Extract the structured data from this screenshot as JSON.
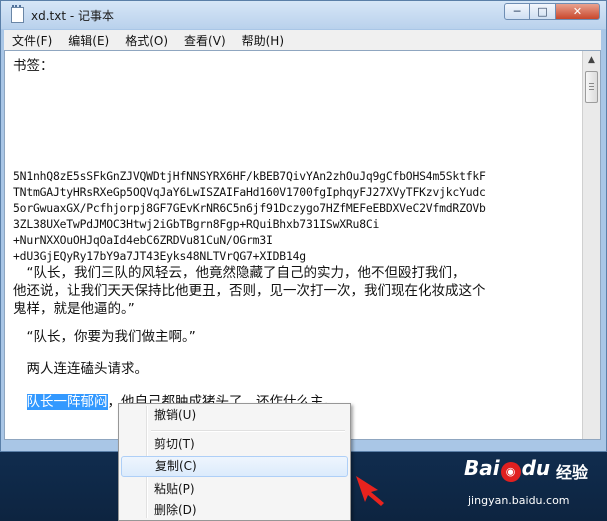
{
  "window": {
    "title": "xd.txt - 记事本",
    "controls": {
      "minimize": "─",
      "maximize": "□",
      "close": "✕"
    }
  },
  "menu": [
    "文件(F)",
    "编辑(E)",
    "格式(O)",
    "查看(V)",
    "帮助(H)"
  ],
  "editor": {
    "header": "书签：",
    "encoded_lines": [
      "5N1nhQ8zE5sSFkGnZJVQWDtjHfNNSYRX6HF/kBEB7QivYAn2zhOuJq9gCfbOHS4m5SktfkF",
      "TNtmGAJtyHRsRXeGp5OQVqJaY6LwISZAIFaHd160V1700fgIphqyFJ27XVyTFKzvjkcYudc",
      "5orGwuaxGX/Pcfhjorpj8GF7GEvKrNR6C5n6jf91Dczygo7HZfMEFeEBDXVeC2VfmdRZOVb",
      "3ZL38UXeTwPdJMOC3Htwj2iGbTBgrn8Fgp+RQuiBhxb731ISwXRu8Ci",
      "+NurNXXOuOHJqOaId4ebC6ZRDVu81CuN/OGrm3I",
      "+dU3GjEQyRy17bY9a7JT43Eyks48NLTVrQG7+XIDB14g"
    ],
    "para1": [
      "　“队长，我们三队的风轻云，他竟然隐藏了自己的实力，他不但殴打我们，",
      "他还说，让我们天天保持比他更丑，否则，见一次打一次，我们现在化妆成这个",
      "鬼样，就是他逼的。”"
    ],
    "para2": "　“队长，你要为我们做主啊。”",
    "para3": "　两人连连磕头请求。",
    "para4_selected": "队长一阵郁闷",
    "para4_rest": "，他自己都肿成猪头了，还作什么主。"
  },
  "context_menu": {
    "items": [
      "撤销(U)",
      "剪切(T)",
      "复制(C)",
      "粘贴(P)",
      "删除(D)"
    ],
    "highlighted": "复制(C)"
  },
  "watermark": {
    "logo_pre": "Bai",
    "logo_paw": "du",
    "brand": "经验",
    "url": "jingyan.baidu.com"
  }
}
